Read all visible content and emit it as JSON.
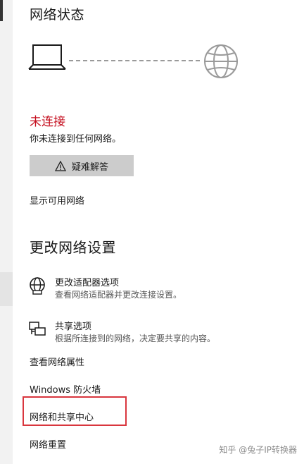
{
  "header": {
    "title": "网络状态"
  },
  "status": {
    "state": "未连接",
    "description": "你未连接到任何网络。",
    "troubleshoot_label": "疑难解答",
    "show_networks_link": "显示可用网络"
  },
  "settings": {
    "title": "更改网络设置",
    "items": [
      {
        "title": "更改适配器选项",
        "desc": "查看网络适配器并更改连接设置。",
        "icon": "adapter-globe-icon"
      },
      {
        "title": "共享选项",
        "desc": "根据所连接到的网络，决定要共享的内容。",
        "icon": "sharing-icon"
      }
    ]
  },
  "links": {
    "network_properties": "查看网络属性",
    "firewall": "Windows 防火墙",
    "sharing_center": "网络和共享中心",
    "network_reset": "网络重置"
  },
  "watermark": "知乎 @兔子IP转换器",
  "colors": {
    "disconnected": "#c50f1f",
    "highlight": "#d9363e",
    "button_bg": "#cccccc"
  }
}
